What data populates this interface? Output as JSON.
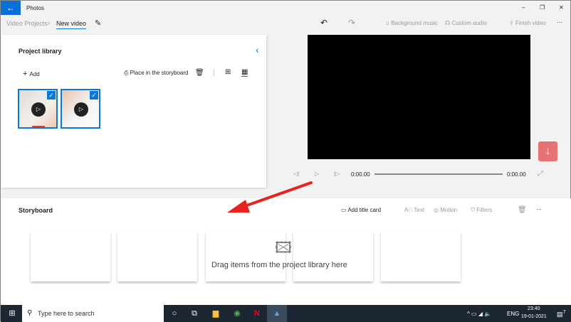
{
  "titlebar": {
    "app": "Photos",
    "minimize": "–",
    "restore": "❐",
    "close": "✕"
  },
  "breadcrumb": {
    "parent": "Video Projects",
    "current": "New video"
  },
  "toolbar": {
    "background_music": "Background music",
    "custom_audio": "Custom audio",
    "finish_video": "Finish video",
    "more": "···"
  },
  "library": {
    "title": "Project library",
    "add": "Add",
    "place": "Place in the storyboard",
    "items": [
      {
        "selected": true
      },
      {
        "selected": true
      }
    ]
  },
  "player": {
    "time_start": "0:00.00",
    "time_end": "0:00.00",
    "progress": 0
  },
  "storyboard": {
    "title": "Storyboard",
    "add_title_card": "Add title card",
    "text": "Text",
    "motion": "Motion",
    "filters": "Filters",
    "more": "···",
    "empty_message": "Drag items from the project library here"
  },
  "taskbar": {
    "search_placeholder": "Type here to search",
    "language": "ENG",
    "time": "23:40",
    "date": "19-01-2021",
    "notifications": "7"
  },
  "colors": {
    "accent": "#0a78d7",
    "annotation_arrow": "#e8231f",
    "download_button": "#e57373"
  }
}
